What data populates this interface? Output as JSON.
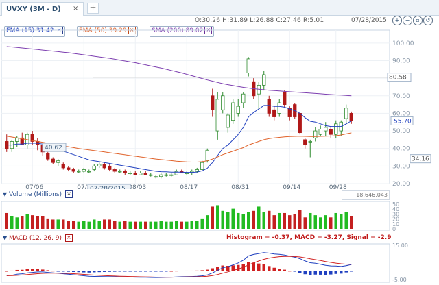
{
  "tab": {
    "label": "UVXY (3M - D)",
    "close": "×",
    "add": "+"
  },
  "header": {
    "ohlc": "O:30.26 H:31.89 L:26.88 C:27.46 R:5.01",
    "date": "07/28/2015",
    "zoom_buttons": [
      "zoom-in-icon",
      "zoom-out-icon",
      "zoom-fit-icon",
      "zoom-reset-icon"
    ]
  },
  "legend": [
    {
      "label": "EMA (15) 31.42",
      "color": "#1f3fbf",
      "close": "×"
    },
    {
      "label": "EMA (50) 39.29",
      "color": "#e0622a",
      "close": "×"
    },
    {
      "label": "SMA (200) 89.02",
      "color": "#7d3fb0",
      "close": "×"
    }
  ],
  "price_axis": [
    "100.00",
    "90.00",
    "80.00",
    "70.00",
    "60.00",
    "50.00",
    "40.00",
    "30.00",
    "20.00"
  ],
  "time_axis": [
    "07/06",
    "07/20",
    "08/03",
    "08/17",
    "08/31",
    "09/14",
    "09/28"
  ],
  "markers": {
    "left_price": "40.62",
    "hline_price": "80.58",
    "last_price": "55.70",
    "right_low": "34.16",
    "crosshair_date": "07/28/2015"
  },
  "volume": {
    "title": "Volume (Millions)",
    "value": "18,646,043",
    "axis": [
      "50",
      "40",
      "30",
      "20",
      "10",
      "0"
    ]
  },
  "macd": {
    "title": "MACD (12, 26, 9)",
    "readout": "Histogram = -0.37, MACD = -3.27, Signal = -2.9",
    "axis": [
      "15.00",
      "-5.00"
    ]
  },
  "colors": {
    "up": "#2e8b2e",
    "down": "#b01818",
    "ema15": "#1f3fbf",
    "ema50": "#e0622a",
    "sma200": "#7d3fb0",
    "up_volume": "#22bb22",
    "down_volume": "#c42020"
  },
  "chart_data": {
    "type": "candlestick",
    "ylim": [
      20,
      105
    ],
    "x_ticks": [
      "07/06",
      "07/20",
      "08/03",
      "08/17",
      "08/31",
      "09/14",
      "09/28"
    ],
    "candles": [
      {
        "o": 44,
        "h": 48,
        "l": 38,
        "c": 40
      },
      {
        "o": 40,
        "h": 45,
        "l": 38,
        "c": 44
      },
      {
        "o": 44,
        "h": 47,
        "l": 41,
        "c": 46
      },
      {
        "o": 46,
        "h": 49,
        "l": 42,
        "c": 42
      },
      {
        "o": 42,
        "h": 49,
        "l": 40,
        "c": 48
      },
      {
        "o": 48,
        "h": 50,
        "l": 42,
        "c": 44
      },
      {
        "o": 44,
        "h": 46,
        "l": 39,
        "c": 42
      },
      {
        "o": 42,
        "h": 43,
        "l": 36,
        "c": 38
      },
      {
        "o": 37,
        "h": 38,
        "l": 33,
        "c": 34
      },
      {
        "o": 34,
        "h": 35,
        "l": 31,
        "c": 32
      },
      {
        "o": 32,
        "h": 34,
        "l": 30,
        "c": 33
      },
      {
        "o": 31,
        "h": 32,
        "l": 28,
        "c": 29
      },
      {
        "o": 29,
        "h": 30,
        "l": 27,
        "c": 28
      },
      {
        "o": 28,
        "h": 29,
        "l": 26,
        "c": 27
      },
      {
        "o": 27,
        "h": 28,
        "l": 26,
        "c": 27
      },
      {
        "o": 27,
        "h": 29,
        "l": 26,
        "c": 28
      },
      {
        "o": 27,
        "h": 28,
        "l": 26,
        "c": 27
      },
      {
        "o": 28,
        "h": 31,
        "l": 27,
        "c": 30
      },
      {
        "o": 30,
        "h": 32,
        "l": 29,
        "c": 31
      },
      {
        "o": 31,
        "h": 32,
        "l": 28,
        "c": 29
      },
      {
        "o": 30,
        "h": 31,
        "l": 27,
        "c": 28
      },
      {
        "o": 28,
        "h": 29,
        "l": 26,
        "c": 27
      },
      {
        "o": 27,
        "h": 28,
        "l": 26,
        "c": 27
      },
      {
        "o": 27,
        "h": 28,
        "l": 25,
        "c": 26
      },
      {
        "o": 26,
        "h": 27,
        "l": 25,
        "c": 26
      },
      {
        "o": 26,
        "h": 27,
        "l": 25,
        "c": 25
      },
      {
        "o": 25,
        "h": 27,
        "l": 25,
        "c": 26
      },
      {
        "o": 26,
        "h": 27,
        "l": 25,
        "c": 25
      },
      {
        "o": 25,
        "h": 26,
        "l": 24,
        "c": 25
      },
      {
        "o": 24,
        "h": 25,
        "l": 23,
        "c": 24
      },
      {
        "o": 24,
        "h": 26,
        "l": 23,
        "c": 25
      },
      {
        "o": 25,
        "h": 26,
        "l": 24,
        "c": 25
      },
      {
        "o": 25,
        "h": 26,
        "l": 24,
        "c": 25
      },
      {
        "o": 25,
        "h": 28,
        "l": 25,
        "c": 27
      },
      {
        "o": 27,
        "h": 28,
        "l": 26,
        "c": 26
      },
      {
        "o": 26,
        "h": 27,
        "l": 25,
        "c": 26
      },
      {
        "o": 26,
        "h": 28,
        "l": 25,
        "c": 27
      },
      {
        "o": 27,
        "h": 29,
        "l": 26,
        "c": 28
      },
      {
        "o": 28,
        "h": 33,
        "l": 28,
        "c": 32
      },
      {
        "o": 33,
        "h": 40,
        "l": 32,
        "c": 39
      },
      {
        "o": 70,
        "h": 74,
        "l": 58,
        "c": 62
      },
      {
        "o": 50,
        "h": 72,
        "l": 45,
        "c": 68
      },
      {
        "o": 62,
        "h": 72,
        "l": 60,
        "c": 70
      },
      {
        "o": 52,
        "h": 60,
        "l": 49,
        "c": 59
      },
      {
        "o": 56,
        "h": 68,
        "l": 54,
        "c": 66
      },
      {
        "o": 60,
        "h": 68,
        "l": 58,
        "c": 64
      },
      {
        "o": 66,
        "h": 72,
        "l": 63,
        "c": 71
      },
      {
        "o": 83,
        "h": 92,
        "l": 81,
        "c": 91
      },
      {
        "o": 78,
        "h": 80,
        "l": 68,
        "c": 70
      },
      {
        "o": 71,
        "h": 78,
        "l": 62,
        "c": 76
      },
      {
        "o": 76,
        "h": 84,
        "l": 73,
        "c": 82
      },
      {
        "o": 68,
        "h": 70,
        "l": 58,
        "c": 60
      },
      {
        "o": 62,
        "h": 64,
        "l": 56,
        "c": 58
      },
      {
        "o": 60,
        "h": 68,
        "l": 58,
        "c": 66
      },
      {
        "o": 72,
        "h": 73,
        "l": 63,
        "c": 65
      },
      {
        "o": 63,
        "h": 64,
        "l": 56,
        "c": 58
      },
      {
        "o": 65,
        "h": 66,
        "l": 57,
        "c": 58
      },
      {
        "o": 60,
        "h": 61,
        "l": 48,
        "c": 49
      },
      {
        "o": 45,
        "h": 46,
        "l": 40,
        "c": 42
      },
      {
        "o": 44,
        "h": 45,
        "l": 35,
        "c": 44
      },
      {
        "o": 46,
        "h": 52,
        "l": 44,
        "c": 50
      },
      {
        "o": 48,
        "h": 53,
        "l": 47,
        "c": 51
      },
      {
        "o": 50,
        "h": 55,
        "l": 47,
        "c": 52
      },
      {
        "o": 51,
        "h": 52,
        "l": 46,
        "c": 48
      },
      {
        "o": 48,
        "h": 56,
        "l": 46,
        "c": 54
      },
      {
        "o": 50,
        "h": 56,
        "l": 47,
        "c": 55
      },
      {
        "o": 57,
        "h": 65,
        "l": 54,
        "c": 63
      },
      {
        "o": 60,
        "h": 61,
        "l": 54,
        "c": 56
      }
    ],
    "ema15": [
      42,
      42,
      42.5,
      42.5,
      43,
      43,
      43,
      42.5,
      41.5,
      40.5,
      39.5,
      38.5,
      37.5,
      36.5,
      35.5,
      34.5,
      33.5,
      33,
      32.5,
      32,
      31.5,
      31,
      30.5,
      30,
      29.5,
      29,
      28.5,
      28,
      27.5,
      27,
      26.8,
      26.7,
      26.5,
      26.5,
      26.5,
      26.4,
      26.4,
      26.6,
      27.3,
      28.8,
      32,
      36,
      40,
      42,
      45,
      48,
      52,
      58,
      60.5,
      62.5,
      64.5,
      64.5,
      64,
      64,
      63.5,
      62.5,
      61.5,
      60,
      57.5,
      55.5,
      55,
      54,
      53,
      52.5,
      52.5,
      52.5,
      54,
      55.7
    ],
    "ema50": [
      47,
      46.5,
      46,
      45.5,
      45,
      44.5,
      44,
      43.5,
      43,
      42.5,
      42,
      41.5,
      41,
      40.5,
      40,
      39.6,
      39.2,
      38.8,
      38.4,
      38,
      37.6,
      37.2,
      36.8,
      36.4,
      36,
      35.6,
      35.2,
      34.8,
      34.4,
      34,
      33.7,
      33.4,
      33.1,
      32.8,
      32.6,
      32.4,
      32.3,
      32.3,
      32.5,
      33,
      34,
      35.2,
      36.5,
      37.5,
      38.5,
      39.5,
      40.5,
      42,
      43,
      44,
      45,
      45.6,
      46,
      46.3,
      46.6,
      46.8,
      46.9,
      47,
      46.9,
      46.8,
      46.8,
      46.9,
      47,
      47.1,
      47.3,
      47.7,
      48.3,
      48.9
    ],
    "sma200": [
      98,
      97.8,
      97.5,
      97.2,
      96.9,
      96.6,
      96.3,
      96,
      95.7,
      95.4,
      95.1,
      94.8,
      94.5,
      94.1,
      93.7,
      93.3,
      92.9,
      92.5,
      92.1,
      91.7,
      91.3,
      90.8,
      90.3,
      89.8,
      89.3,
      88.8,
      88.2,
      87.6,
      87,
      86.4,
      85.8,
      85.1,
      84.4,
      83.7,
      83,
      82.2,
      81.4,
      80.6,
      79.8,
      79,
      78.3,
      77.6,
      76.9,
      76.3,
      75.8,
      75.3,
      74.8,
      74.4,
      74,
      73.7,
      73.4,
      73.1,
      72.9,
      72.7,
      72.5,
      72.3,
      72.1,
      71.9,
      71.7,
      71.5,
      71.3,
      71.1,
      70.9,
      70.7,
      70.5,
      70.4,
      70.2,
      70
    ]
  }
}
